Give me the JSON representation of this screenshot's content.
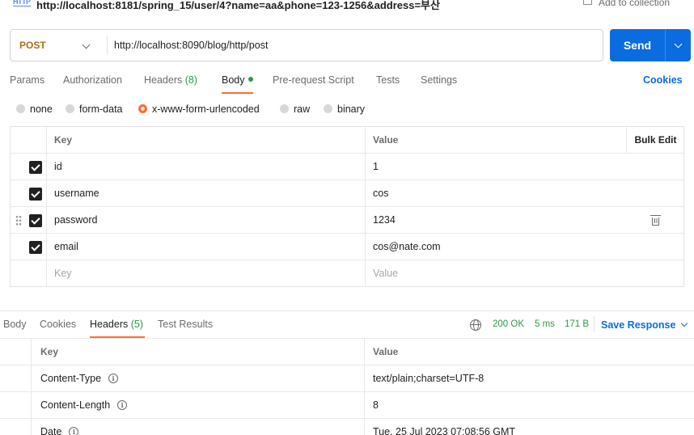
{
  "header": {
    "icon_text": "HTTP",
    "request_title": "http://localhost:8181/spring_15/user/4?name=aa&phone=123-1256&address=부산",
    "add_to_collection": "Add to collection"
  },
  "request": {
    "method": "POST",
    "url": "http://localhost:8090/blog/http/post",
    "send_label": "Send"
  },
  "tabs": [
    {
      "label": "Params"
    },
    {
      "label": "Authorization"
    },
    {
      "label": "Headers",
      "count": "(8)"
    },
    {
      "label": "Body"
    },
    {
      "label": "Pre-request Script"
    },
    {
      "label": "Tests"
    },
    {
      "label": "Settings"
    }
  ],
  "cookies_label": "Cookies",
  "body_modes": [
    "none",
    "form-data",
    "x-www-form-urlencoded",
    "raw",
    "binary"
  ],
  "body_mode_selected": "x-www-form-urlencoded",
  "form_table": {
    "headers": {
      "key": "Key",
      "value": "Value",
      "bulk_edit": "Bulk Edit"
    },
    "rows": [
      {
        "key": "id",
        "value": "1",
        "checked": true
      },
      {
        "key": "username",
        "value": "cos",
        "checked": true
      },
      {
        "key": "password",
        "value": "1234",
        "checked": true
      },
      {
        "key": "email",
        "value": "cos@nate.com",
        "checked": true
      }
    ],
    "placeholder": {
      "key": "Key",
      "value": "Value"
    }
  },
  "response": {
    "tabs": [
      {
        "label": "Body"
      },
      {
        "label": "Cookies"
      },
      {
        "label": "Headers",
        "count": "(5)"
      },
      {
        "label": "Test Results"
      }
    ],
    "status": "200 OK",
    "time": "5 ms",
    "size": "171 B",
    "save_response": "Save Response",
    "headers_table": {
      "headers": {
        "key": "Key",
        "value": "Value"
      },
      "rows": [
        {
          "key": "Content-Type",
          "value": "text/plain;charset=UTF-8"
        },
        {
          "key": "Content-Length",
          "value": "8"
        },
        {
          "key": "Date",
          "value": "Tue, 25 Jul 2023 07:08:56 GMT"
        }
      ]
    }
  },
  "colors": {
    "accent_orange": "#ff6c37",
    "send_blue": "#0b6ce0",
    "method_post": "#a86f1a",
    "status_green": "#2a9a4a"
  },
  "icons": [
    "http-icon",
    "add-collection-icon",
    "chevron-down-icon",
    "drag-handle-icon",
    "trash-icon",
    "globe-icon",
    "info-icon"
  ]
}
